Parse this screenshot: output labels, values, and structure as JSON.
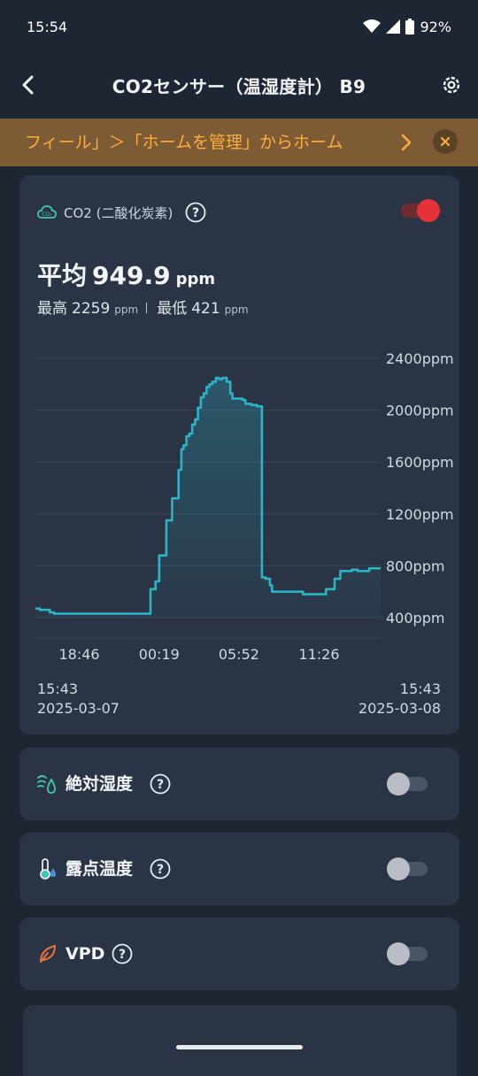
{
  "status_bar": {
    "time": "15:54",
    "battery": "92%"
  },
  "app_bar": {
    "title": "CO2センサー（温湿度計） B9",
    "back_icon": "chevron-left-icon",
    "settings_icon": "gear-icon"
  },
  "banner": {
    "text": "フィール」＞「ホームを管理」からホーム",
    "chevron_icon": "chevron-right-icon",
    "close_icon": "close-icon",
    "color": "#ffae3b"
  },
  "co2_card": {
    "icon": "co2-cloud-icon",
    "label": "CO2 (二酸化炭素)",
    "help_icon": "question-circle-icon",
    "toggle_on": true,
    "avg_label": "平均",
    "avg_value": "949.9",
    "avg_unit": "ppm",
    "max_label": "最高",
    "max_value": "2259",
    "min_label": "最低",
    "min_value": "421",
    "unit": "ppm",
    "range_start_time": "15:43",
    "range_start_date": "2025-03-07",
    "range_end_time": "15:43",
    "range_end_date": "2025-03-08"
  },
  "chart_data": {
    "type": "area",
    "title": "",
    "xlabel": "",
    "ylabel": "",
    "line_color": "#2bb3c6",
    "x_ticks": [
      "18:46",
      "00:19",
      "05:52",
      "11:26"
    ],
    "y_ticks": [
      "400ppm",
      "800ppm",
      "1200ppm",
      "1600ppm",
      "2000ppm",
      "2400ppm"
    ],
    "y_tick_values": [
      400,
      800,
      1200,
      1600,
      2000,
      2400
    ],
    "ylim": [
      400,
      2400
    ],
    "x_range": [
      "2025-03-07 15:43",
      "2025-03-08 15:43"
    ],
    "x_tick_hours": [
      3.05,
      8.6,
      14.15,
      19.72
    ],
    "series": [
      {
        "x_hours": [
          0,
          0.3,
          0.9,
          1.0,
          1.3,
          6.5,
          7.45,
          7.6,
          7.85,
          8.0,
          8.35,
          8.6,
          8.95,
          9.1,
          9.35,
          9.5,
          9.85,
          9.95,
          10.15,
          10.3,
          10.5,
          10.7,
          10.9,
          11.1,
          11.3,
          11.5,
          11.7,
          11.9,
          12.1,
          12.3,
          12.55,
          12.75,
          13.0,
          13.3,
          13.55,
          13.7,
          13.95,
          14.1,
          14.4,
          14.6,
          15.0,
          15.4,
          15.6,
          15.75,
          16.0,
          16.3,
          16.45,
          16.6,
          16.9,
          17.4,
          18.0,
          18.6,
          19.2,
          19.8,
          20.2,
          20.8,
          21.2,
          21.6,
          22.0,
          22.4,
          22.8,
          23.2,
          23.6,
          24.0
        ],
        "values": [
          470,
          460,
          460,
          440,
          430,
          430,
          430,
          430,
          430,
          620,
          680,
          880,
          880,
          1150,
          1150,
          1320,
          1320,
          1540,
          1700,
          1730,
          1800,
          1820,
          1890,
          1930,
          2020,
          2100,
          2130,
          2180,
          2200,
          2220,
          2250,
          2240,
          2250,
          2220,
          2130,
          2090,
          2090,
          2090,
          2080,
          2050,
          2040,
          2030,
          2030,
          710,
          700,
          650,
          600,
          600,
          600,
          600,
          600,
          580,
          580,
          580,
          620,
          700,
          760,
          760,
          770,
          760,
          760,
          780,
          780,
          780
        ]
      }
    ]
  },
  "features": [
    {
      "icon": "wind-drop-icon",
      "label": "絶対湿度",
      "help_icon": "question-circle-icon",
      "toggle_on": false
    },
    {
      "icon": "thermometer-drop-icon",
      "label": "露点温度",
      "help_icon": "question-circle-icon",
      "toggle_on": false
    },
    {
      "icon": "leaf-icon",
      "label": "VPD",
      "help_icon": "question-circle-icon",
      "toggle_on": false
    }
  ]
}
